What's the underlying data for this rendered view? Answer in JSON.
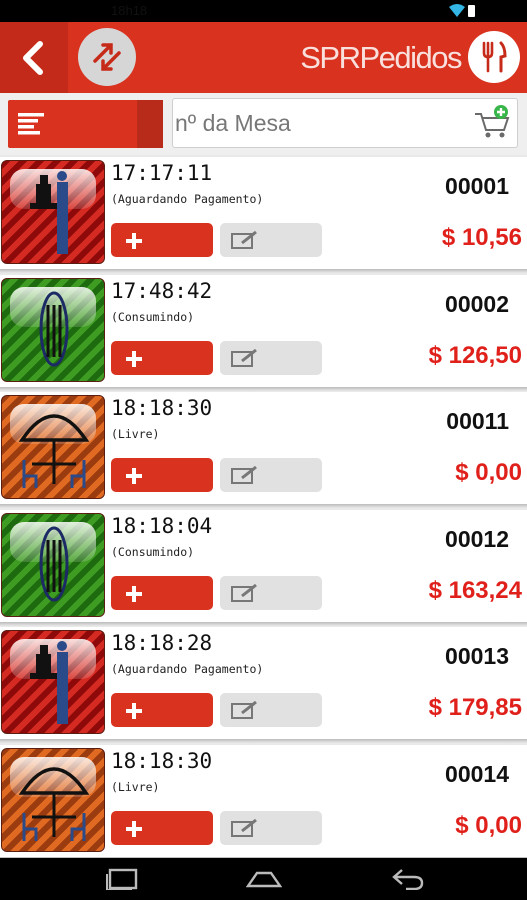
{
  "status_bar": {
    "time": "18h18",
    "icons": [
      "wifi-icon",
      "battery-icon"
    ]
  },
  "action_bar": {
    "brand": "SPRPedidos",
    "icons": [
      "back-arrow-icon",
      "swap-icon",
      "fork-knife-icon"
    ]
  },
  "toolbar": {
    "search_placeholder": "nº da Mesa",
    "icons": [
      "menu-lines-icon",
      "add-to-cart-icon"
    ]
  },
  "colors": {
    "primary": "#d9321f",
    "price": "#e0201a",
    "waiting_payment": "#c41414",
    "consuming": "#2f8a19",
    "free": "#d4581c"
  },
  "tables": [
    {
      "time": "17:17:11",
      "status": "(Aguardando Pagamento)",
      "number": "00001",
      "total": "$ 10,56",
      "state": "waiting-payment"
    },
    {
      "time": "17:48:42",
      "status": "(Consumindo)",
      "number": "00002",
      "total": "$ 126,50",
      "state": "consuming"
    },
    {
      "time": "18:18:30",
      "status": "(Livre)",
      "number": "00011",
      "total": "$ 0,00",
      "state": "free"
    },
    {
      "time": "18:18:04",
      "status": "(Consumindo)",
      "number": "00012",
      "total": "$ 163,24",
      "state": "consuming"
    },
    {
      "time": "18:18:28",
      "status": "(Aguardando Pagamento)",
      "number": "00013",
      "total": "$ 179,85",
      "state": "waiting-payment"
    },
    {
      "time": "18:18:30",
      "status": "(Livre)",
      "number": "00014",
      "total": "$ 0,00",
      "state": "free"
    }
  ],
  "row_buttons": {
    "add_icon": "plus-icon",
    "edit_icon": "edit-note-icon"
  },
  "nav_bar": {
    "icons": [
      "recent-apps-icon",
      "home-icon",
      "back-icon"
    ]
  }
}
